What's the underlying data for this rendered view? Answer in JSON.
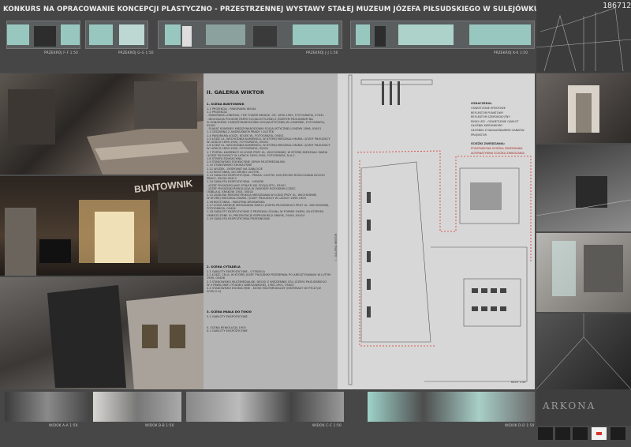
{
  "header": {
    "title": "KONKURS NA OPRACOWANIE KONCEPCJI PLASTYCZNO - PRZESTRZENNEJ WYSTAWY STAŁEJ MUZEUM JÓZEFA PIŁSUDSKIEGO W SULEJÓWKU",
    "ref_number": "186712"
  },
  "elevations": {
    "labels": [
      "PRZEKRÓJ F-F 1:50",
      "PRZEKRÓJ G-G 1:50",
      "PRZEKRÓJ J-J 1:50",
      "PRZEKRÓJ K-K 1:50"
    ]
  },
  "photos": {
    "sign_text": "BUNTOWNIK"
  },
  "gallery": {
    "title": "II. GALERIA WIKTOR",
    "section1_title": "1. SCENA BUNTOWNIK",
    "section1_items": [
      "1.1 PROJEKCJA - PANORAMA WILNA",
      "1.2 PROJEKCJA",
      "- PANORAMA LONDYNU, THE TOWER BRIDGE, OK. 1890-1905, FOTOGRAFIA, 07431",
      "- DELEGACJA POLSKIEJ PARTII SOCJALISTYCZNEJ Z JÓZEFEM PIŁSUDSKIM NA",
      "IV KONGRESIE II MIĘDZYNARODÓWKI SOCJALISTYCZNEJ W LONDYNIE, FOTOGRAFIA,",
      "05401",
      "- PLAKAT KONGRES MIĘDZYNARODÓWKI SOCJALISTYCZNEJ LONDYN 1896, 05401",
      "1.3 GEDZIBNA Z ANDRUSKIEM PRADY I ULOTEK",
      "1.4 PANORAMA ŁODZI, KOLEK W., FOTOGRAFIA, 05401",
      "1.5 ŁÓDŹ UL. WSCHODNIA KAMIENICA, W KTÓREJ MIESZKALI MARIA I JÓZEF PIŁSUDSCY",
      "W LATACH 1899-1900, FOTOGRAFIA, 05401",
      "1.6 ŁÓDŹ UL. WSCHODNIA KAMIENICA, W KTÓREJ MIESZKALI MARIA I JÓZEF PIŁSUDSCY",
      "W LATACH 1899-1900, FOTOGRAFIA, 05401",
      "1.7 PORTAL KAMIENICY W ŁODZI PRZY UL. WSCHODNIEJ, W KTÓREJ MIESZKALI MARIA",
      "I JÓZEF PIŁSUDSCY W LATACH 1899-1900, FOTOGRAFIA, N.A.C.",
      "1.8 STREFA EDUKACYJNA",
      "1.9 STANOWISKO EDUKACYJNE (DRUK MULTIMEDIALNA)",
      "1.10 STANOWISKO EDUKACYJNE",
      "1.11 WOZEK - EKSPONAT NA GABLOCIE",
      "1.12 BOSTONKA, DO DRUKU ULOTEK",
      "1.13 GABLOTA EKSPOZYCYJNA - PRASA I ULOTKI, KSIĄŻECZKI ROZLICZANIA DOCHU",
      "PRACY, 05433-05412",
      "1.14 GABLOTA EKSPOZYCYJNA - HISAZKI",
      "- JÓZEF PIŁSUDSKI JAKO STAŁEM SIĘ SOCJALISTĄ, 05401",
      "- JÓZEF PIŁSUDSKI REWOLUCJA W ZABORZE ROSYJSKIM CZĘŚĆ",
      "I BIBLIA.K. KRAKÓW 1903, 05402",
      "1.15 DUDLINA REKONSTRUKCJA MIESZKANIA W ŁODZI PRZY UL. WSCHODNIEJ",
      "W KTÓREJ MIESZKALI MARIA I JÓZEF PIŁSUDSCY W LATACH 1899-1900",
      "1.16 BOSTONKA - MASZYNA DRUKARSKA",
      "1.17 ŁÓDŹ ARENCJE MIESZKANIA MARII I JÓZEFA PIŁSUDSKICH PRZY UL. WSCHODNIEJ,",
      "FOTOGRAFIA, 05404",
      "1.18 GABLOTY EKSPOZYCYJNE Z PRZEDNIĄ ŚCIANĄ W FORMIE OKIEN, ZA KTÓRYMI",
      "UMIESZCZONE SĄ PREZENTACJE REPRODUKCJI GRAFIK, 05401-05410",
      "1.19 GABLOTA EKSPOZYCYJNA PRZEDNIOWA"
    ],
    "section2_title": "2. SCENA CYTADELA",
    "section2_items": [
      "2.1 GABLOTY EKSPOZYCYJNE - CYTADELA",
      "2.2 ŁÓDŹ, CELA, W KTÓREJ JÓZEF PIŁSUDSKI PRZEBYWAŁ PO ARESZTOWANIU W LUTYM",
      "1900, 05408",
      "2.3 STANOWISKO MULTIMEDIALNE: DROGI Z WIĘZIENNEJ CELI JÓZEFA PIŁSUDSKIEGO",
      "W X PAWILONIE CYTADELI WARSZAWSKIEJ, 1900-1901, 05402",
      "2.4 STANOWISKO EDUKACYJNE - KIOSK MULTIMEDIALNY (MATERIAŁY DOTYCZĄCE",
      "SCEN 2-4)"
    ],
    "section3_title": "3. SCENA MIAŁA DO TOKIO",
    "section3_items": [
      "3.1 GABLOTY EKSPOZYCYJNE"
    ],
    "section4_items": [
      "4. SCENA REWOLUCJA 1905",
      "4.1 GABLOTY EKSPOZYCYJNE"
    ]
  },
  "plan": {
    "legend_title": "OZNACZENIA:",
    "legend_items": [
      "OŚWIETLENIE EFEKTOWE",
      "REFLEKTOR PUNKTOWY",
      "REFLEKTOR SZEROKOKĄTNY",
      "PASKI LED - OŚWIETLENIE GABLOT",
      "GŁOŚNIK KIERUNKOWY",
      "GŁOŚNIKI Z NAGŁAŚNIANIEM GANKÓW",
      "PROJEKTOR"
    ],
    "visit_title": "ŚCIEŻKI ZWIEDZANIA:",
    "visit_items": [
      "PODSTAWOWA ŚCIEŻKA ZWIEDZANIA",
      "ALTERNATYWNA ŚCIEŻKA ZWIEDZANIA"
    ],
    "plan_caption": "RZUT 1:50",
    "section_mark": "I - GALERIA WIKTOR"
  },
  "bottom": {
    "labels": [
      "WIDOK A-A 1:50",
      "WIDOK B-B 1:50",
      "WIDOK C-C 1:50",
      "WIDOK D-D 1:50"
    ],
    "watermark": "ARKONA"
  },
  "colors": {
    "background": "#4a4a4a",
    "accent_turquoise": "#9fd3ca",
    "plan_paper": "#d7d7d7",
    "path_red": "#d9342b"
  }
}
